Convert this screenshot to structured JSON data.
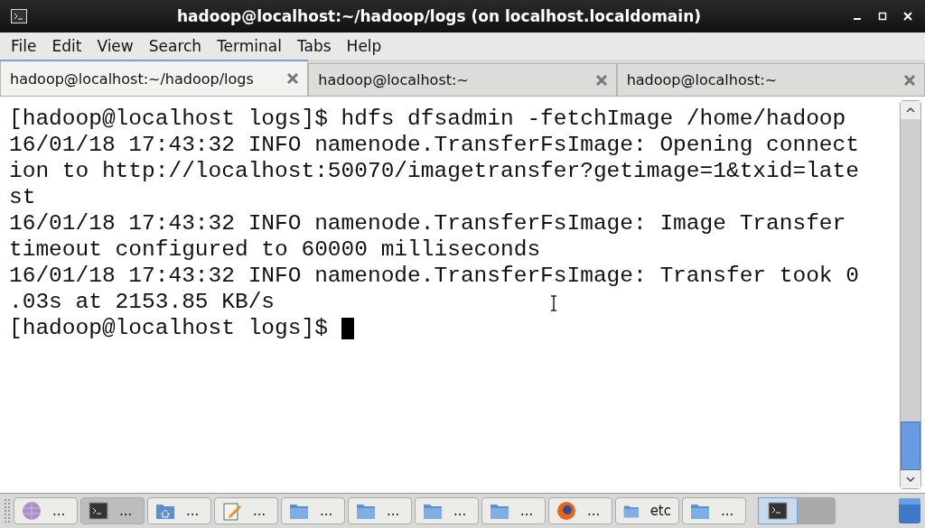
{
  "window": {
    "title": "hadoop@localhost:~/hadoop/logs (on localhost.localdomain)"
  },
  "menu": [
    "File",
    "Edit",
    "View",
    "Search",
    "Terminal",
    "Tabs",
    "Help"
  ],
  "tabs": [
    {
      "label": "hadoop@localhost:~/hadoop/logs",
      "selected": true
    },
    {
      "label": "hadoop@localhost:~",
      "selected": false
    },
    {
      "label": "hadoop@localhost:~",
      "selected": false
    }
  ],
  "terminal": {
    "lines": [
      "[hadoop@localhost logs]$ hdfs dfsadmin -fetchImage /home/hadoop",
      "16/01/18 17:43:32 INFO namenode.TransferFsImage: Opening connect",
      "ion to http://localhost:50070/imagetransfer?getimage=1&txid=late",
      "st",
      "16/01/18 17:43:32 INFO namenode.TransferFsImage: Image Transfer",
      "timeout configured to 60000 milliseconds",
      "16/01/18 17:43:32 INFO namenode.TransferFsImage: Transfer took 0",
      ".03s at 2153.85 KB/s"
    ],
    "prompt": "[hadoop@localhost logs]$ "
  },
  "taskbar": [
    {
      "kind": "globe",
      "label": "...",
      "selected": false
    },
    {
      "kind": "terminal",
      "label": "...",
      "selected": true
    },
    {
      "kind": "home",
      "label": "...",
      "selected": false
    },
    {
      "kind": "notepad",
      "label": "...",
      "selected": false
    },
    {
      "kind": "folder",
      "label": "...",
      "selected": false
    },
    {
      "kind": "folder",
      "label": "...",
      "selected": false
    },
    {
      "kind": "folder",
      "label": "...",
      "selected": false
    },
    {
      "kind": "folder",
      "label": "...",
      "selected": false
    },
    {
      "kind": "browser",
      "label": "...",
      "selected": false
    },
    {
      "kind": "folder",
      "label": "etc",
      "selected": false
    },
    {
      "kind": "folder",
      "label": "...",
      "selected": false
    }
  ]
}
